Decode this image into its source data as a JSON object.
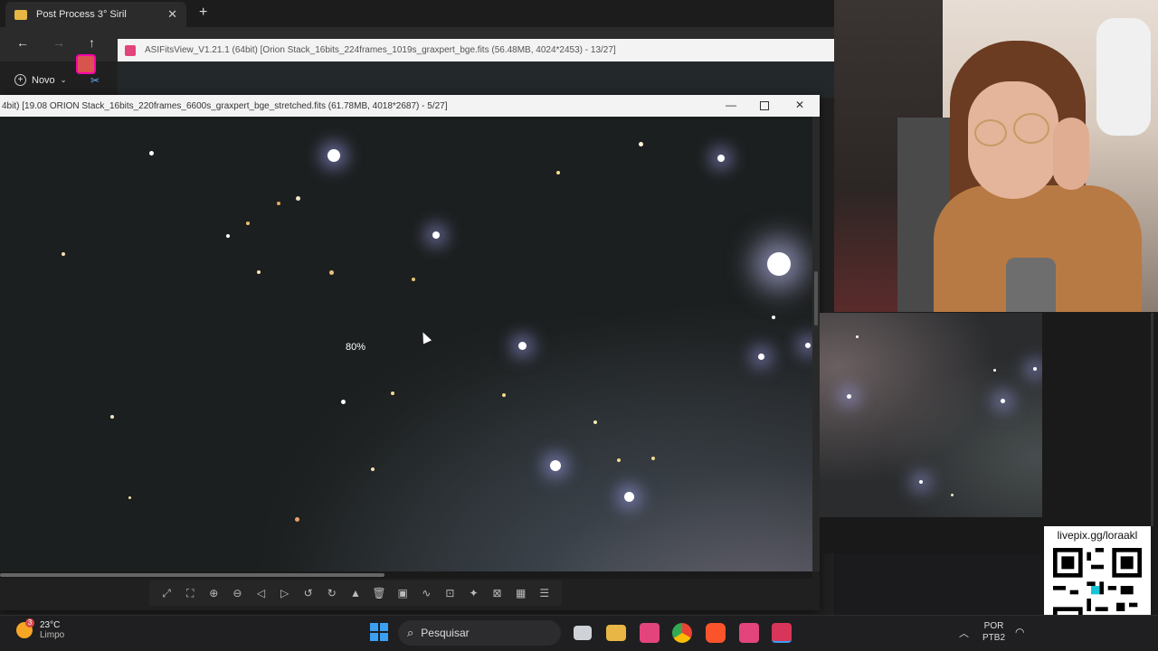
{
  "explorer": {
    "tab_title": "Post Process 3° Siril",
    "new_label": "Novo"
  },
  "back_window": {
    "title": "ASIFitsView_V1.21.1 (64bit) [Orion Stack_16bits_224frames_1019s_graxpert_bge.fits (56.48MB, 4024*2453) - 13/27]"
  },
  "front_window": {
    "title": "4bit) [19.08 ORION Stack_16bits_220frames_6600s_graxpert_bge_stretched.fits (61.78MB, 4018*2687) - 5/27]",
    "zoom": "80%"
  },
  "toolbar": {
    "icons": [
      "fit-icon",
      "crop-icon",
      "zoom-in-icon",
      "zoom-out-icon",
      "prev-icon",
      "next-icon",
      "rotate-left-icon",
      "rotate-right-icon",
      "stretch-icon",
      "delete-icon",
      "save-icon",
      "histogram-icon",
      "info-icon",
      "star-icon",
      "compare-icon",
      "grid-icon",
      "menu-icon"
    ]
  },
  "overlay": {
    "livepix": "livepix.gg/loraakl"
  },
  "taskbar": {
    "weather_temp": "23°C",
    "weather_condition": "Limpo",
    "weather_badge": "3",
    "search_placeholder": "Pesquisar",
    "lang_line1": "POR",
    "lang_line2": "PTB2"
  },
  "colors": {
    "accent": "#3b9ff2",
    "app_brand": "#e3447c"
  }
}
